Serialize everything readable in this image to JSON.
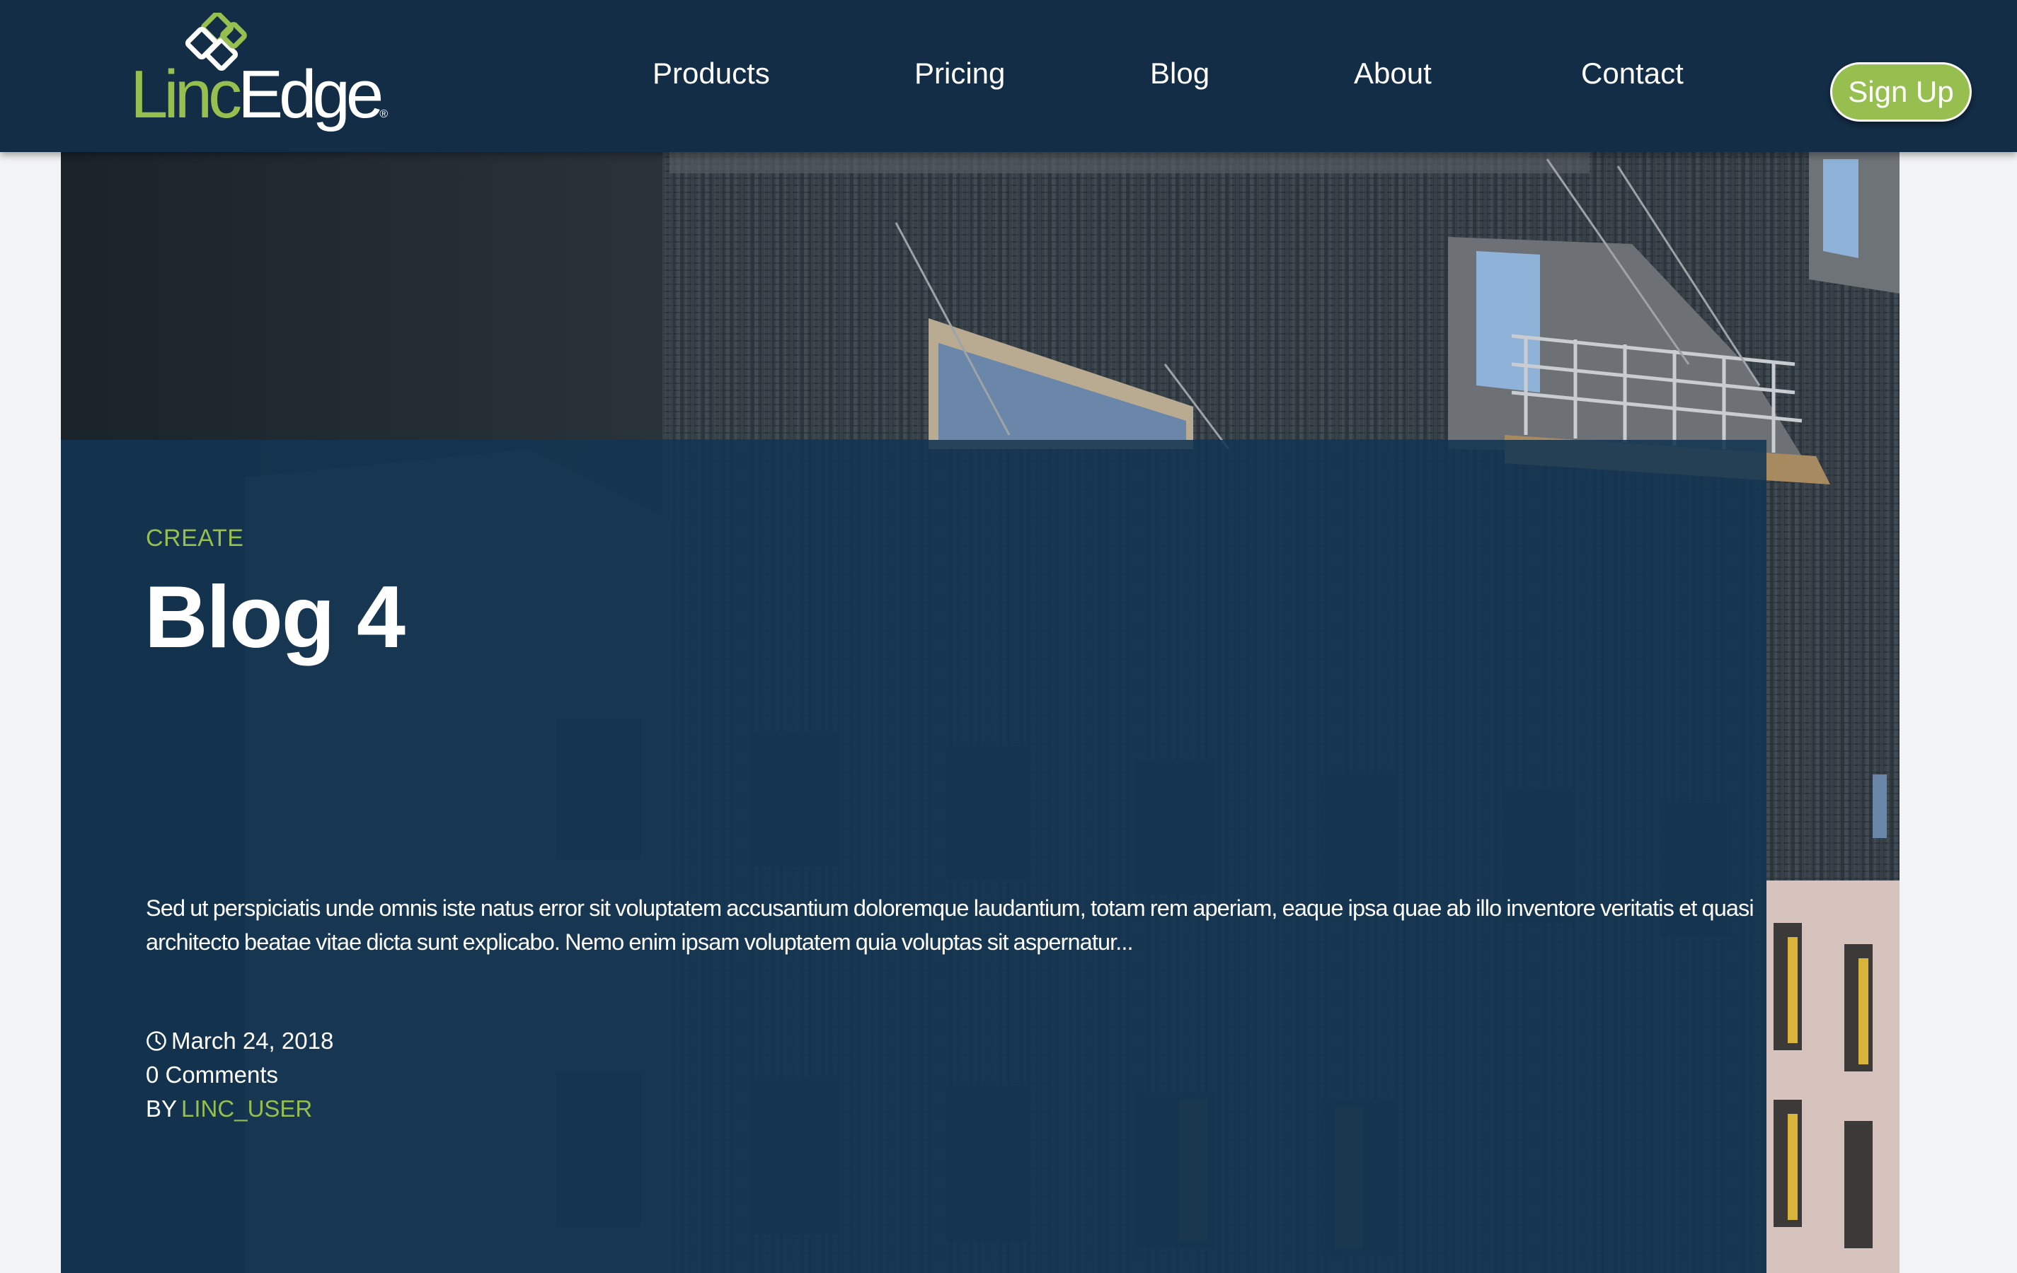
{
  "brand": {
    "name_part1": "Linc",
    "name_part2": "Edge",
    "registered_mark": "®",
    "logo_icon": "linked-squares-logo-icon"
  },
  "nav": {
    "items": [
      {
        "label": "Products"
      },
      {
        "label": "Pricing"
      },
      {
        "label": "Blog"
      },
      {
        "label": "About"
      },
      {
        "label": "Contact"
      }
    ],
    "signup_label": "Sign Up"
  },
  "post": {
    "category": "CREATE",
    "title": "Blog 4",
    "excerpt": "Sed ut perspiciatis unde omnis iste natus error sit voluptatem accusantium doloremque laudantium, totam rem aperiam, eaque ipsa quae ab illo inventore veritatis et quasi architecto beatae vitae dicta sunt explicabo. Nemo enim ipsam voluptatem quia voluptas sit aspernatur...",
    "date": "March 24, 2018",
    "comments": "0 Comments",
    "by_label": "BY",
    "author": "LINC_USER",
    "date_icon": "clock-icon"
  },
  "colors": {
    "navbar_bg": "#122d45",
    "accent_green": "#97bf4f",
    "overlay_bg": "#123452",
    "page_bg": "#f2f3f4",
    "text_white": "#ffffff"
  }
}
